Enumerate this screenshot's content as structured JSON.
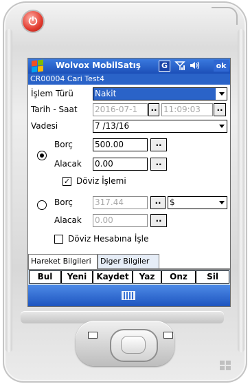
{
  "device": {
    "power_icon": "power-icon",
    "hw_left_icon": "calendar-icon",
    "hw_right_icon": "contacts-icon"
  },
  "titlebar": {
    "app_title": "Wolvox MobilSatış",
    "g_badge": "G",
    "signal_icon": "signal-icon",
    "volume_icon": "volume-icon",
    "ok_label": "ok",
    "subtitle": "CR00004 Cari Test4"
  },
  "form": {
    "islem_turu_label": "İşlem Türü",
    "islem_turu_value": "Nakit",
    "tarih_saat_label": "Tarih - Saat",
    "tarih_value": "2016-07-1",
    "saat_value": "11:09:03",
    "dots_label": "..",
    "vadesi_label": "Vadesi",
    "vadesi_value": "7 /13/16",
    "group1": {
      "borc_label": "Borç",
      "borc_value": "500.00",
      "alacak_label": "Alacak",
      "alacak_value": "0.00",
      "doviz_islemi_label": "Döviz İşlemi",
      "doviz_islemi_checked": true,
      "selected": true
    },
    "group2": {
      "borc_label": "Borç",
      "borc_value": "317.44",
      "currency_value": "$",
      "alacak_label": "Alacak",
      "alacak_value": "0.00",
      "doviz_hesabina_label": "Döviz Hesabına İşle",
      "doviz_hesabina_checked": false,
      "selected": false
    }
  },
  "tabs": [
    {
      "label": "Hareket Bilgileri",
      "active": true
    },
    {
      "label": "Diger Bilgiler",
      "active": false
    }
  ],
  "toolbar": {
    "buttons": [
      "Bul",
      "Yeni",
      "Kaydet",
      "Yaz",
      "Onz",
      "Sil"
    ]
  },
  "sipbar": {
    "keyboard_icon": "keyboard-icon"
  },
  "colors": {
    "titlebar_blue": "#1c4fb8",
    "selection_blue": "#2a63c8",
    "toolbar_bg": "#c9dcef",
    "power_red": "#e23b2f"
  }
}
